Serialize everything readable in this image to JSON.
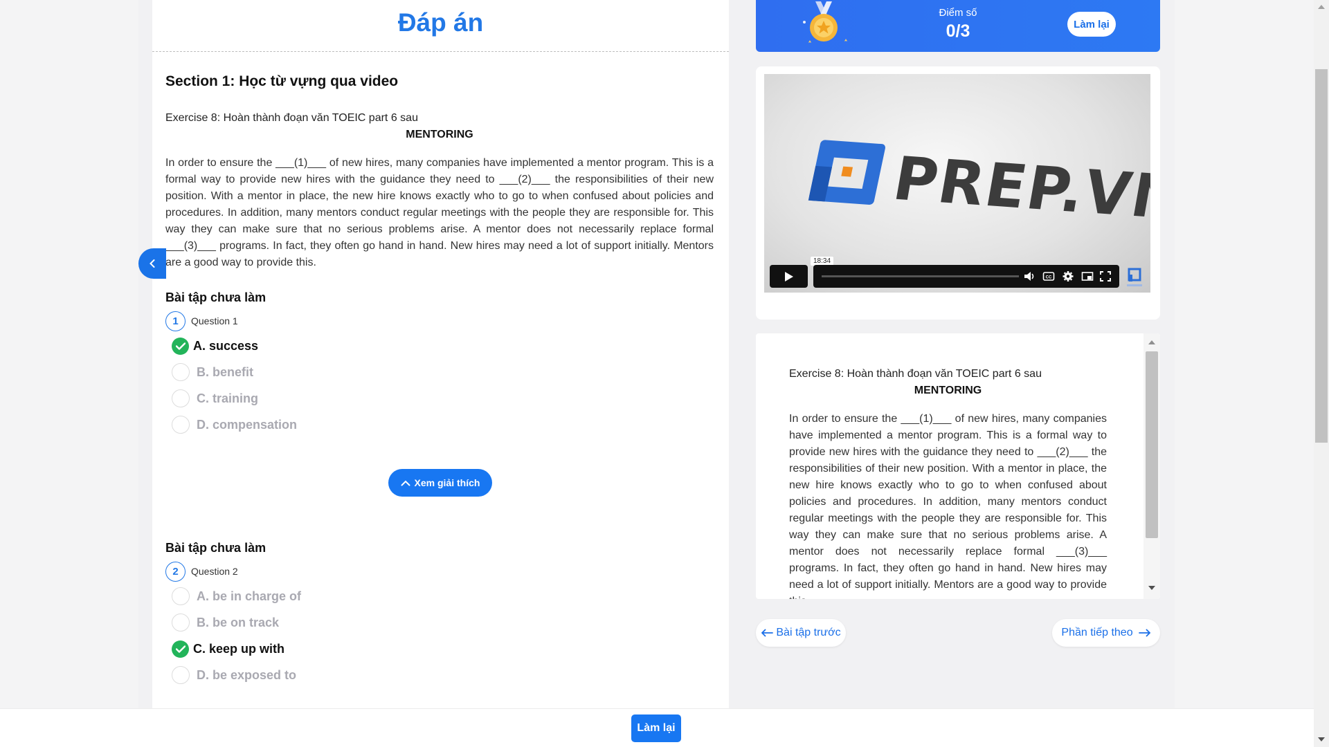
{
  "answer_title": "Đáp án",
  "section_title": "Section 1: Học từ vựng qua video",
  "exercise": {
    "title": "Exercise 8: Hoàn thành đoạn văn TOEIC part 6 sau",
    "subtitle": "MENTORING",
    "passage": "In order to ensure the ___(1)___ of new hires, many companies have implemented a mentor program. This is a formal way to provide new hires with the guidance they need to ___(2)___ the responsibilities of their new position. With a mentor in place, the new hire knows exactly who to go to when confused about policies and procedures. In addition, many mentors conduct regular meetings with the people they are responsible for. This way they can make sure that no serious problems arise. A mentor does not necessarily replace formal ___(3)___ programs. In fact, they often go hand in hand. New hires may need a lot of support initially. Mentors are a good way to provide this."
  },
  "right_passage": "In order to ensure the ___(1)___ of new hires, many companies have implemented a mentor program. This is a formal way to provide new hires with the guidance they need to ___(2)___ the responsibilities of their new position. With a mentor in place, the new hire knows exactly who to go to when confused about policies and procedures. In addition, many mentors conduct regular meetings with the people they are responsible for. This way they can make sure that no serious problems arise. A mentor does not necessarily replace formal ___(3)___ programs. In fact, they often go hand in hand. New hires may need a lot of support initially. Mentors are a good way to provide this.",
  "questions": [
    {
      "heading": "Bài tập chưa làm",
      "number": "1",
      "label": "Question 1",
      "options": [
        "A. success",
        "B. benefit",
        "C. training",
        "D. compensation"
      ],
      "correct_index": 0
    },
    {
      "heading": "Bài tập chưa làm",
      "number": "2",
      "label": "Question 2",
      "options": [
        "A. be in charge of",
        "B. be on track",
        "C. keep up with",
        "D. be exposed to"
      ],
      "correct_index": 2
    }
  ],
  "explain_button": "Xem giải thích",
  "score": {
    "label": "Điểm số",
    "value": "0/3",
    "retry_label": "Làm lại"
  },
  "video": {
    "brand": "PREP.VN",
    "time_tooltip": "18:34",
    "progress": 0
  },
  "nav": {
    "prev_label": "Bài tập trước",
    "next_label": "Phần tiếp theo"
  },
  "bottom_retry": "Làm lại",
  "colors": {
    "accent": "#2278e6",
    "correct": "#22b45a",
    "muted_option": "#a9a9b1"
  },
  "icons": [
    "chevron-left-icon",
    "chevron-up-icon",
    "medal-icon",
    "play-icon",
    "volume-icon",
    "cc-icon",
    "settings-icon",
    "miniplayer-icon",
    "fullscreen-icon",
    "arrow-left-icon",
    "arrow-right-icon",
    "check-icon"
  ]
}
